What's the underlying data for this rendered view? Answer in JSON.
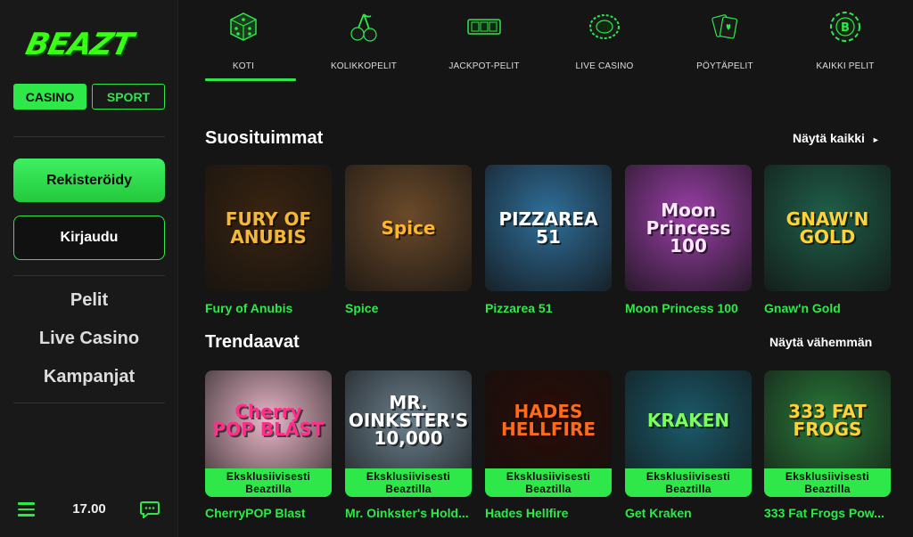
{
  "brand": {
    "logo_text": "BEAZT",
    "accent": "#2ee84a"
  },
  "sidebar": {
    "mode_tabs": [
      {
        "label": "CASINO",
        "active": true
      },
      {
        "label": "SPORT",
        "active": false
      }
    ],
    "register_label": "Rekisteröidy",
    "login_label": "Kirjaudu",
    "nav": [
      {
        "label": "Pelit"
      },
      {
        "label": "Live Casino"
      },
      {
        "label": "Kampanjat"
      }
    ],
    "time": "17.00"
  },
  "categories": [
    {
      "label": "KOTI",
      "icon": "dice-icon",
      "active": true
    },
    {
      "label": "KOLIKKOPELIT",
      "icon": "cherry-icon",
      "active": false
    },
    {
      "label": "JACKPOT-PELIT",
      "icon": "slot-reels-icon",
      "active": false
    },
    {
      "label": "LIVE CASINO",
      "icon": "roulette-icon",
      "active": false
    },
    {
      "label": "PÖYTÄPELIT",
      "icon": "cards-icon",
      "active": false
    },
    {
      "label": "KAIKKI PELIT",
      "icon": "chip-icon",
      "active": false
    }
  ],
  "popular": {
    "title": "Suosituimmat",
    "more_label": "Näytä kaikki",
    "games": [
      {
        "name": "Fury of Anubis",
        "art": "FURY OF ANUBIS",
        "bg": "#3a2410",
        "fg": "#f5b73a"
      },
      {
        "name": "Spice",
        "art": "Spice",
        "bg": "#6b4a2a",
        "fg": "#ffb52e"
      },
      {
        "name": "Pizzarea 51",
        "art": "PIZZAREA 51",
        "bg": "#2f6f9a",
        "fg": "#ffffff"
      },
      {
        "name": "Moon Princess 100",
        "art": "Moon Princess 100",
        "bg": "#9b3fa8",
        "fg": "#ffe8ff"
      },
      {
        "name": "Gnaw'n Gold",
        "art": "GNAW'N GOLD",
        "bg": "#1f5f4a",
        "fg": "#ffd23a"
      }
    ]
  },
  "trending": {
    "title": "Trendaavat",
    "more_label": "Näytä vähemmän",
    "badge_line1": "Eksklusiivisesti",
    "badge_line2": "Beaztilla",
    "games": [
      {
        "name": "CherryPOP Blast",
        "art": "Cherry POP BLAST",
        "bg": "#e9b7c8",
        "fg": "#ff2f8a"
      },
      {
        "name": "Mr. Oinkster's Hold...",
        "art": "MR. OINKSTER'S 10,000",
        "bg": "#6a7f8c",
        "fg": "#ffffff"
      },
      {
        "name": "Hades Hellfire",
        "art": "HADES HELLFIRE",
        "bg": "#2a0c06",
        "fg": "#ff6a1a"
      },
      {
        "name": "Get Kraken",
        "art": "KRAKEN",
        "bg": "#1b5a6a",
        "fg": "#7cff5a"
      },
      {
        "name": "333 Fat Frogs Pow...",
        "art": "333 FAT FROGS",
        "bg": "#2a7a3a",
        "fg": "#ffd23a"
      }
    ]
  }
}
